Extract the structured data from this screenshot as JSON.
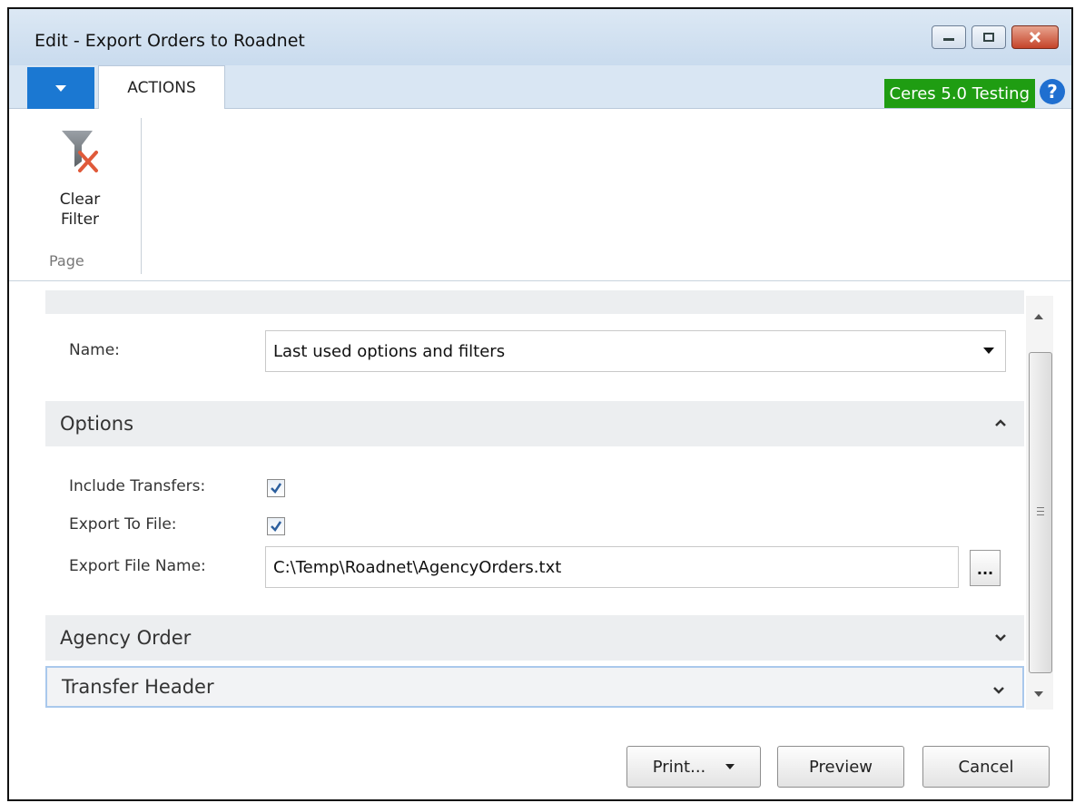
{
  "window": {
    "title": "Edit - Export Orders to Roadnet"
  },
  "ribbon": {
    "tab_actions": "ACTIONS",
    "company": "Ceres 5.0 Testing",
    "clear_filter_line1": "Clear",
    "clear_filter_line2": "Filter",
    "group_label": "Page"
  },
  "saved_settings": {
    "name_label": "Name:",
    "name_value": "Last used options and filters"
  },
  "options": {
    "header": "Options",
    "include_transfers_label": "Include Transfers:",
    "include_transfers_checked": true,
    "export_to_file_label": "Export To File:",
    "export_to_file_checked": true,
    "export_file_name_label": "Export File Name:",
    "export_file_name_value": "C:\\Temp\\Roadnet\\AgencyOrders.txt",
    "assist_button": "..."
  },
  "sections": {
    "agency_order": "Agency Order",
    "transfer_header": "Transfer Header"
  },
  "buttons": {
    "print": "Print...",
    "preview": "Preview",
    "cancel": "Cancel"
  },
  "colors": {
    "menu_blue": "#1b78d2",
    "company_green": "#1f9d12",
    "help_blue": "#1f6fd0",
    "section_bg": "#eceef0"
  }
}
